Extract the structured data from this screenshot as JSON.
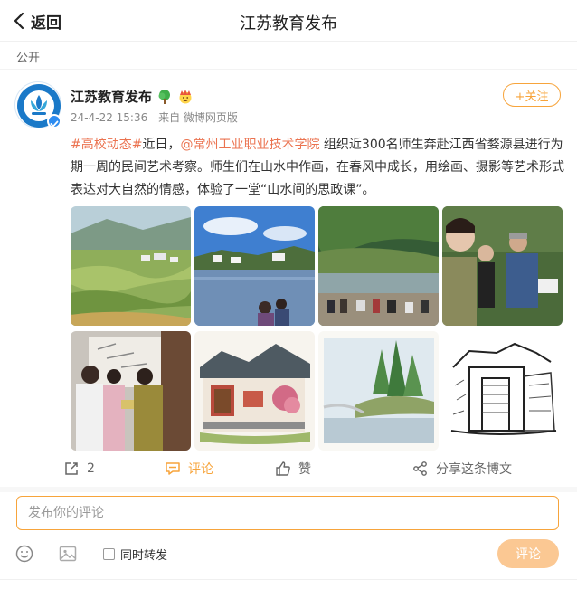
{
  "header": {
    "back_label": "返回",
    "title": "江苏教育发布"
  },
  "visibility": "公开",
  "post": {
    "author": "江苏教育发布",
    "timestamp": "24-4-22 15:36",
    "source": "来自 微博网页版",
    "follow_label": "+关注",
    "hashtag": "#高校动态#",
    "text_before_mention": "近日，",
    "mention": "@常州工业职业技术学院",
    "text_after_mention": " 组织近300名师生奔赴江西省婺源县进行为期一周的民间艺术考察。师生们在山水中作画，在春风中成长，用绘画、摄影等艺术形式表达对大自然的情感，体验了一堂“山水间的思政课”。",
    "photos": [
      {
        "icon": "terraced-village-photo"
      },
      {
        "icon": "lake-village-photo"
      },
      {
        "icon": "riverside-painting-photo"
      },
      {
        "icon": "students-painting-photo"
      },
      {
        "icon": "studio-visit-photo"
      },
      {
        "icon": "watercolor-house-painting"
      },
      {
        "icon": "watercolor-landscape-painting"
      },
      {
        "icon": "ink-sketch-gate-drawing"
      }
    ]
  },
  "actions": {
    "repost_count": "2",
    "comment_label": "评论",
    "like_label": "赞",
    "share_label": "分享这条博文"
  },
  "composer": {
    "placeholder": "发布你的评论",
    "repost_label": "同时转发",
    "submit_label": "评论"
  },
  "colors": {
    "accent": "#f7a43b",
    "link": "#eb7350",
    "submit_bg": "#fbc893"
  }
}
